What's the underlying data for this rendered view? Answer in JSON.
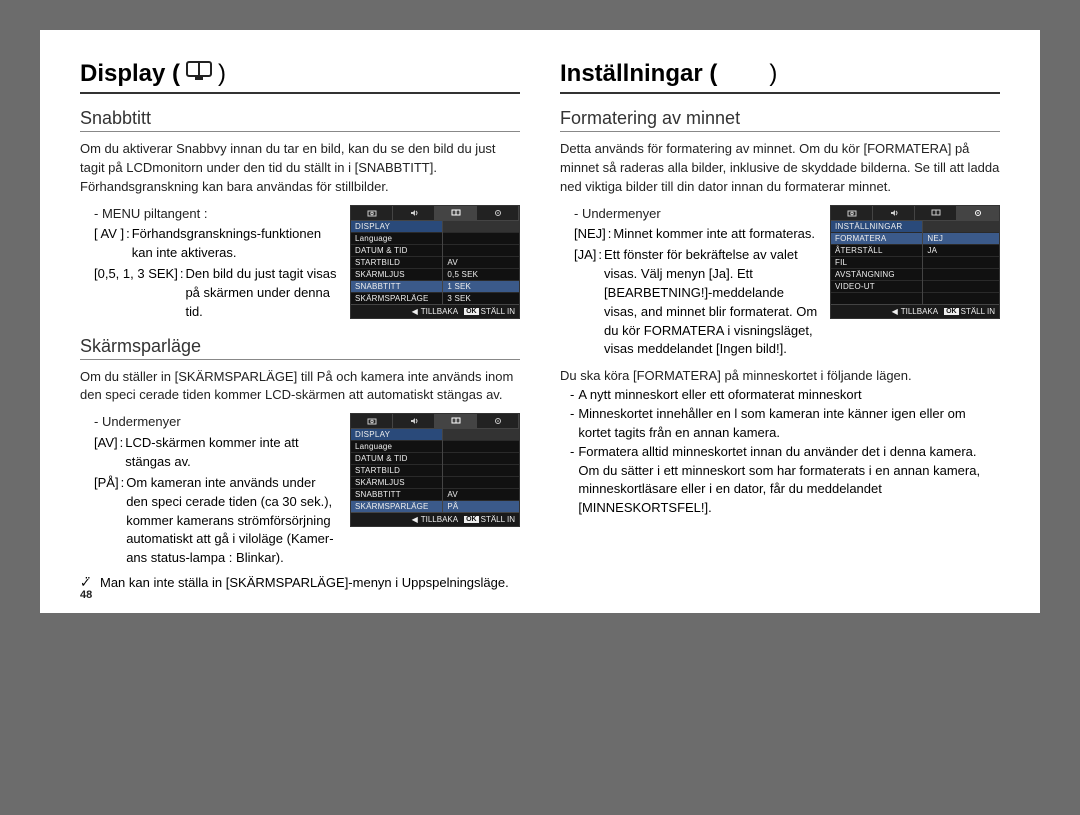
{
  "pageNumber": "48",
  "left": {
    "title_prefix": "Display (",
    "title_suffix": ")",
    "icon": "display-icon",
    "snabbtitt": {
      "heading": "Snabbtitt",
      "p1": "Om du aktiverar Snabbvy innan du tar en bild, kan du se den bild du just tagit på LCDmonitorn under den tid du ställt in i [SNABBTITT]. Förhandsgranskning kan bara användas för stillbilder.",
      "menu_label": "-  MENU piltangent :",
      "opt_av_k": "[ AV ]",
      "opt_av_v": "Förhandsgransknings-funktionen kan inte aktiveras.",
      "opt_sek_k": "[0,5, 1, 3 SEK]",
      "opt_sek_v": "Den bild du just tagit visas på skärmen under denna tid.",
      "screenshot": {
        "header": "DISPLAY",
        "leftItems": [
          "Language",
          "DATUM & TID",
          "STARTBILD",
          "SKÄRMLJUS",
          "SNABBTITT",
          "SKÄRMSPARLÄGE"
        ],
        "rightItems": [
          "AV",
          "0,5 SEK",
          "1 SEK",
          "3 SEK"
        ],
        "highlightLeft": 4,
        "footer_back": "TILLBAKA",
        "footer_ok": "OK",
        "footer_set": "STÄLL IN"
      }
    },
    "skarmspar": {
      "heading": "Skärmsparläge",
      "p1": "Om du ställer in [SKÄRMSPARLÄGE] till På och kamera inte används inom den speci cerade tiden kommer LCD-skärmen att automatiskt stängas av.",
      "menu_label": "-  Undermenyer",
      "opt_av_k": "[AV]",
      "opt_av_v": "LCD-skärmen kommer inte att stängas av.",
      "opt_pa_k": "[PÅ]",
      "opt_pa_v": "Om kameran inte används under den speci cerade tiden (ca 30 sek.), kommer kamerans strömförsörjning automatiskt att gå i viloläge (Kamer-ans status-lampa : Blinkar).",
      "note": "Man kan inte ställa in [SKÄRMSPARLÄGE]-menyn i Uppspelningsläge.",
      "screenshot": {
        "header": "DISPLAY",
        "leftItems": [
          "Language",
          "DATUM & TID",
          "STARTBILD",
          "SKÄRMLJUS",
          "SNABBTITT",
          "SKÄRMSPARLÄGE"
        ],
        "rightItems": [
          "AV",
          "PÅ"
        ],
        "highlightLeft": 5,
        "footer_back": "TILLBAKA",
        "footer_ok": "OK",
        "footer_set": "STÄLL IN"
      }
    }
  },
  "right": {
    "title_prefix": "Inställningar (",
    "title_suffix": ")",
    "format": {
      "heading": "Formatering av minnet",
      "p1": "Detta används för formatering av minnet. Om du kör [FORMATERA] på minnet så raderas alla bilder, inklusive de skyddade bilderna. Se till att ladda ned viktiga bilder till din dator innan du formaterar minnet.",
      "menu_label": "-  Undermenyer",
      "opt_nej_k": "[NEJ]",
      "opt_nej_v": "Minnet kommer inte att formateras.",
      "opt_ja_k": "[JA]",
      "opt_ja_v": "Ett fönster för bekräftelse av valet visas. Välj menyn [Ja]. Ett [BEARBETNING!]-meddelande visas, and minnet blir formaterat. Om du kör FORMATERA i visningsläget, visas meddelandet [Ingen bild!].",
      "p2": "Du ska köra [FORMATERA] på minneskortet i följande lägen.",
      "bullets": [
        "A nytt minneskort eller ett oformaterat minneskort",
        "Minneskortet innehåller en   l som kameran inte känner igen eller om kortet tagits från en annan kamera.",
        "Formatera alltid minneskortet innan du använder det i denna kamera. Om du sätter i ett minneskort som har formaterats i en annan kamera, minneskortläsare eller i en dator, får du meddelandet [MINNESKORTSFEL!]."
      ],
      "screenshot": {
        "header": "INSTÄLLNINGAR",
        "leftItems": [
          "FORMATERA",
          "ÅTERSTÄLL",
          "FIL",
          "AVSTÄNGNING",
          "VIDEO-UT"
        ],
        "rightItems": [
          "NEJ",
          "JA"
        ],
        "highlightLeft": 0,
        "footer_back": "TILLBAKA",
        "footer_ok": "OK",
        "footer_set": "STÄLL IN"
      }
    }
  }
}
